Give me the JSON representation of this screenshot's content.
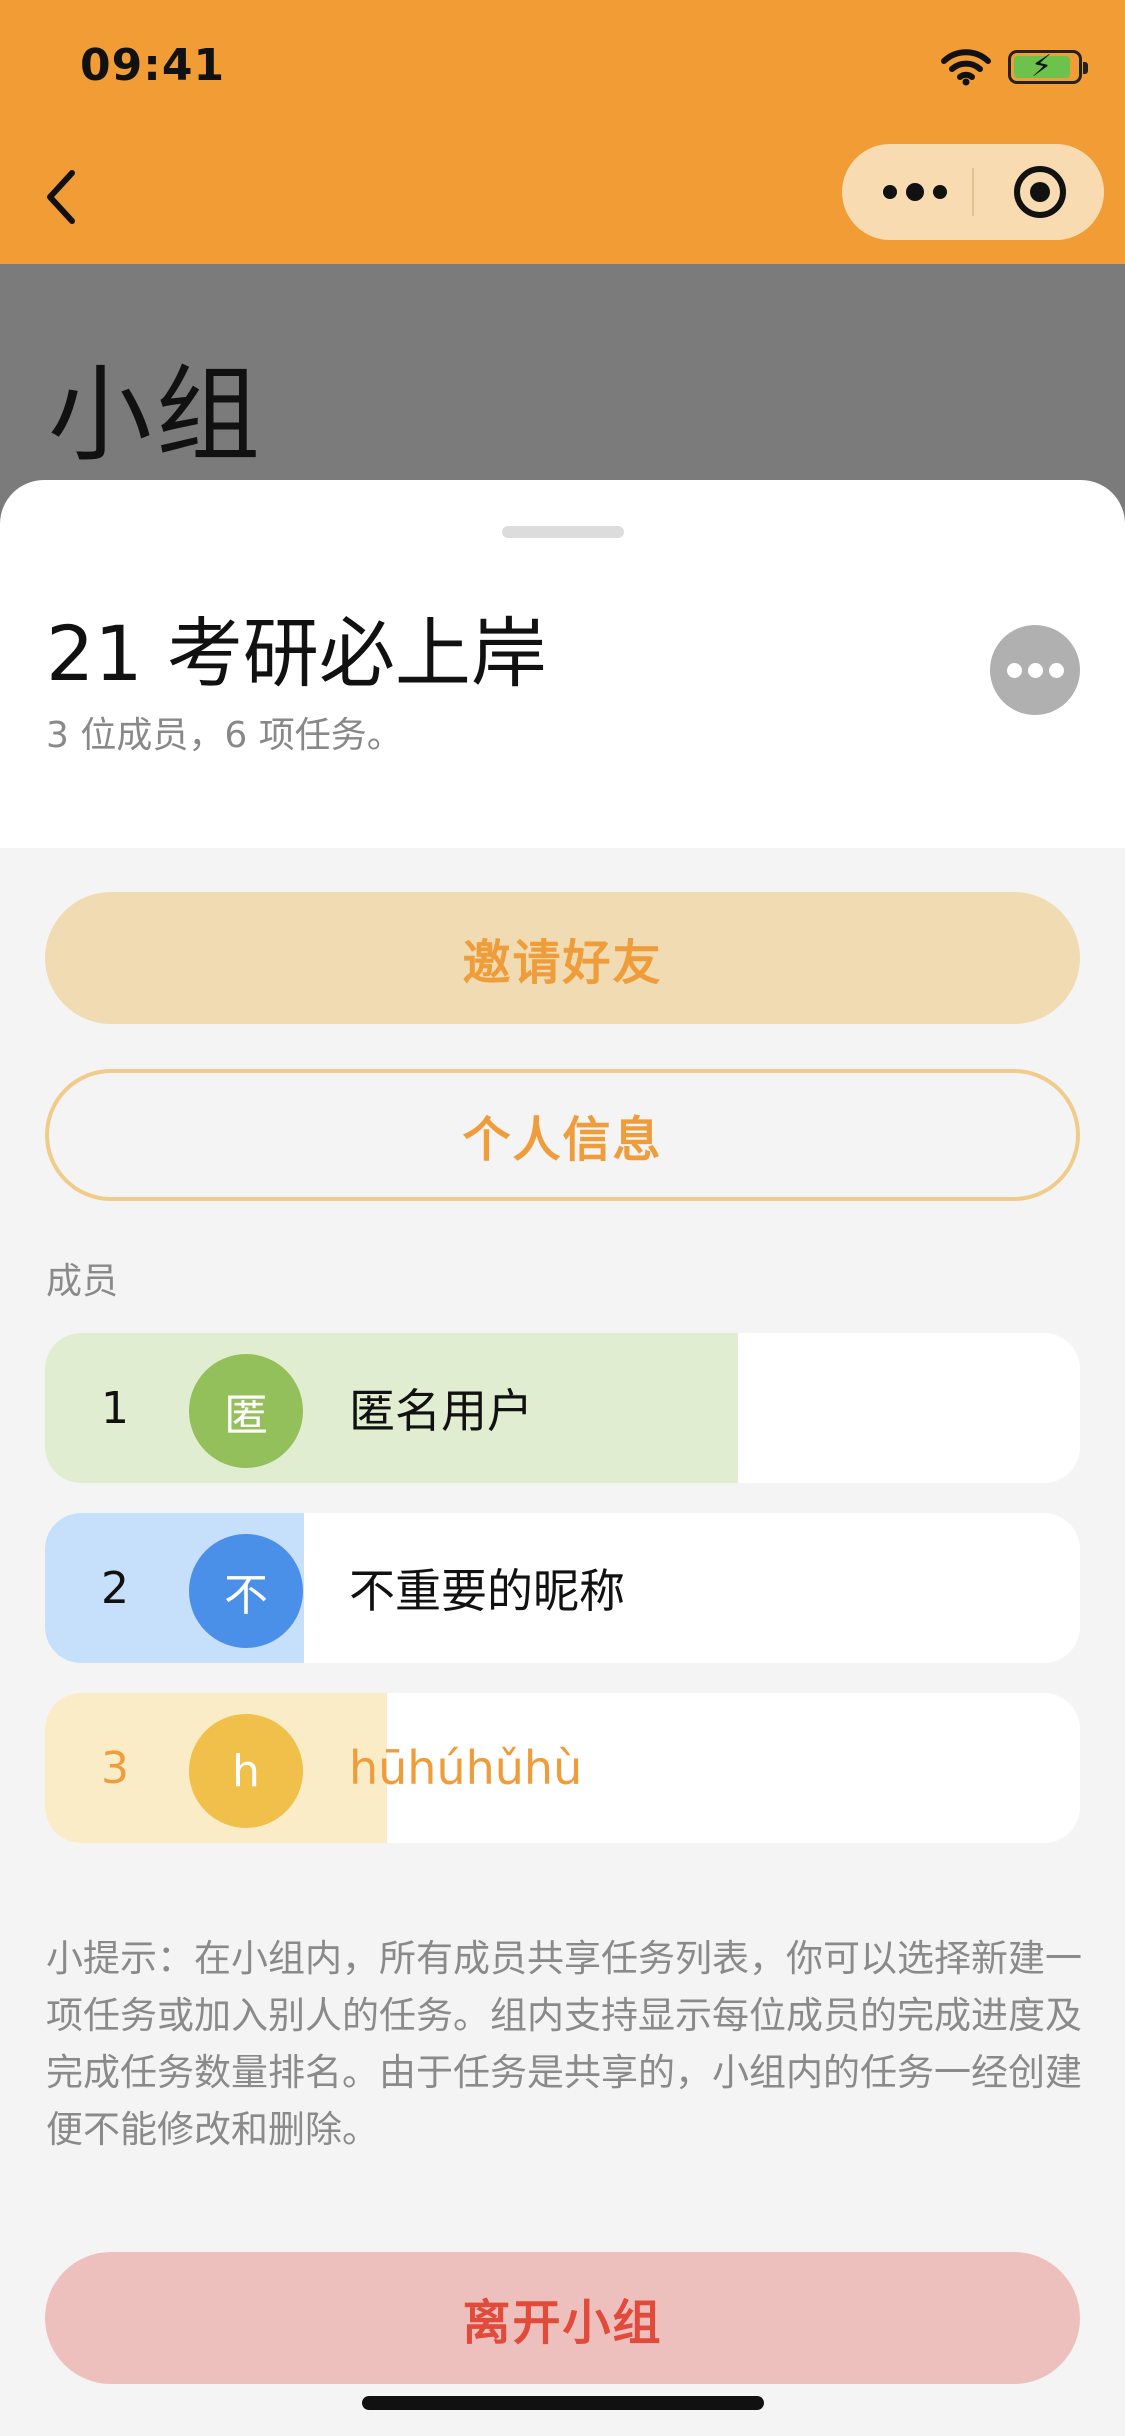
{
  "status_bar": {
    "time": "09:41"
  },
  "nav": {
    "back_icon": "chevron-left-icon",
    "capsule_icons": [
      "more-dots-icon",
      "target-icon"
    ]
  },
  "header": {
    "title": "小组"
  },
  "group": {
    "name": "21 考研必上岸",
    "summary": "3 位成员，6 项任务。",
    "more_icon": "more-dots-icon"
  },
  "actions": {
    "invite_label": "邀请好友",
    "profile_label": "个人信息",
    "leave_label": "离开小组"
  },
  "members_section": {
    "label": "成员",
    "members": [
      {
        "rank": "1",
        "avatar_char": "匿",
        "name": "匿名用户",
        "progress_fraction": 0.67,
        "avatar_color": "#93c05a",
        "progress_color": "#e0edd1",
        "text_color": "#111111"
      },
      {
        "rank": "2",
        "avatar_char": "不",
        "name": "不重要的昵称",
        "progress_fraction": 0.25,
        "avatar_color": "#4a8fe8",
        "progress_color": "#c6dffa",
        "text_color": "#111111"
      },
      {
        "rank": "3",
        "avatar_char": "h",
        "name": "hūhúhǔhù",
        "progress_fraction": 0.33,
        "avatar_color": "#f1c04a",
        "progress_color": "#fbecc8",
        "text_color": "#ef9d3b"
      }
    ]
  },
  "tip": "小提示：在小组内，所有成员共享任务列表，你可以选择新建一项任务或加入别人的任务。组内支持显示每位成员的完成进度及完成任务数量排名。由于任务是共享的，小组内的任务一经创建便不能修改和删除。",
  "colors": {
    "accent": "#f19c34",
    "danger": "#e04b3c"
  }
}
